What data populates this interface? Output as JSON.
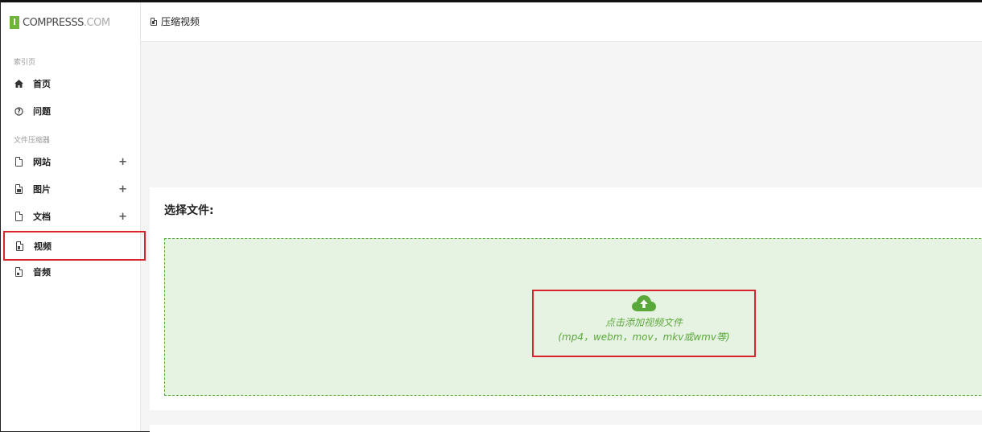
{
  "brand": {
    "name": "COMPRESSS",
    "suffix": ".COM"
  },
  "sidebar": {
    "section_index": "索引页",
    "section_tools": "文件压缩器",
    "items": [
      {
        "label": "首页",
        "icon": "home-icon"
      },
      {
        "label": "问题",
        "icon": "question-icon"
      },
      {
        "label": "网站",
        "icon": "web-file-icon",
        "expand": "+"
      },
      {
        "label": "图片",
        "icon": "image-file-icon",
        "expand": "+"
      },
      {
        "label": "文档",
        "icon": "document-file-icon",
        "expand": "+"
      },
      {
        "label": "视频",
        "icon": "video-file-icon",
        "active": true
      },
      {
        "label": "音频",
        "icon": "audio-file-icon"
      }
    ]
  },
  "header": {
    "title": "压缩视频"
  },
  "main": {
    "select_title": "选择文件:",
    "upload_label": "点击添加视频文件",
    "upload_formats": "(mp4，webm，mov，mkv或wmv等)"
  },
  "colors": {
    "accent": "#5aa83a",
    "highlight": "#d9232d",
    "dropzone_bg": "#e7f3e2"
  }
}
